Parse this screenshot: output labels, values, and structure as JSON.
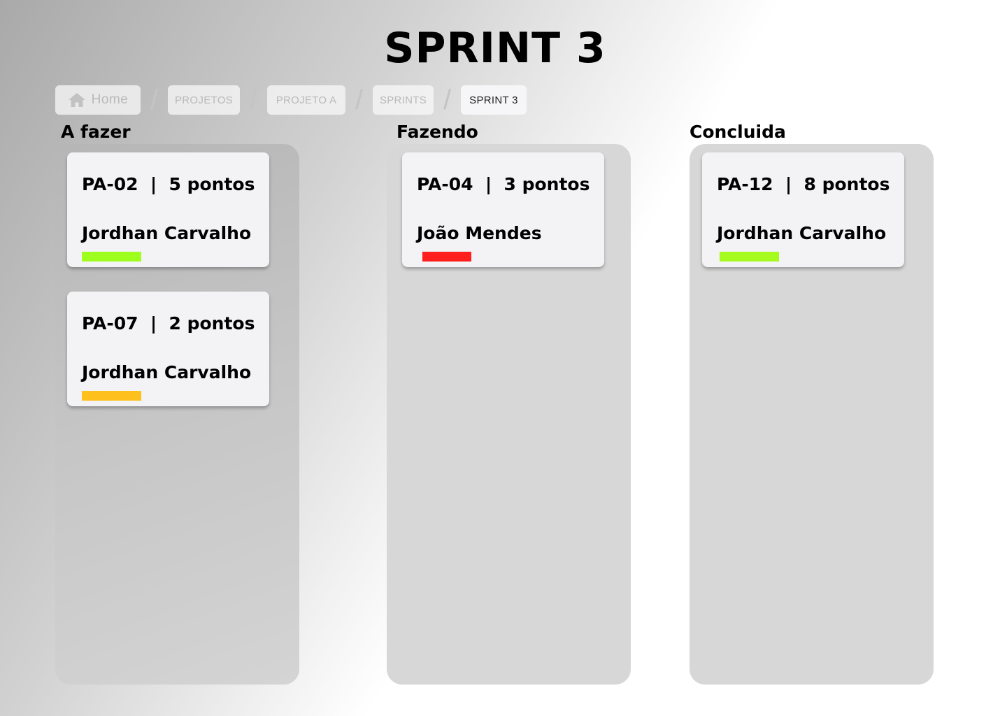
{
  "page": {
    "title": "SPRINT 3"
  },
  "breadcrumb": {
    "home_label": "Home",
    "separator": "/",
    "items": [
      "PROJETOS",
      "PROJETO A",
      "SPRINTS",
      "SPRINT 3"
    ]
  },
  "columns": [
    {
      "title": "A fazer",
      "cards": [
        {
          "title": "PA-02  |  5 pontos",
          "assignee": "Jordhan Carvalho",
          "priority_color": "#9efe1e"
        },
        {
          "title": "PA-07  |  2 pontos",
          "assignee": "Jordhan Carvalho",
          "priority_color": "#fec01c"
        }
      ]
    },
    {
      "title": "Fazendo",
      "cards": [
        {
          "title": "PA-04  |  3 pontos",
          "assignee": "João Mendes",
          "priority_color": "#ff1e1e"
        }
      ]
    },
    {
      "title": "Concluida",
      "cards": [
        {
          "title": "PA-12  |  8 pontos",
          "assignee": "Jordhan Carvalho",
          "priority_color": "#a6fb1e"
        }
      ]
    }
  ]
}
